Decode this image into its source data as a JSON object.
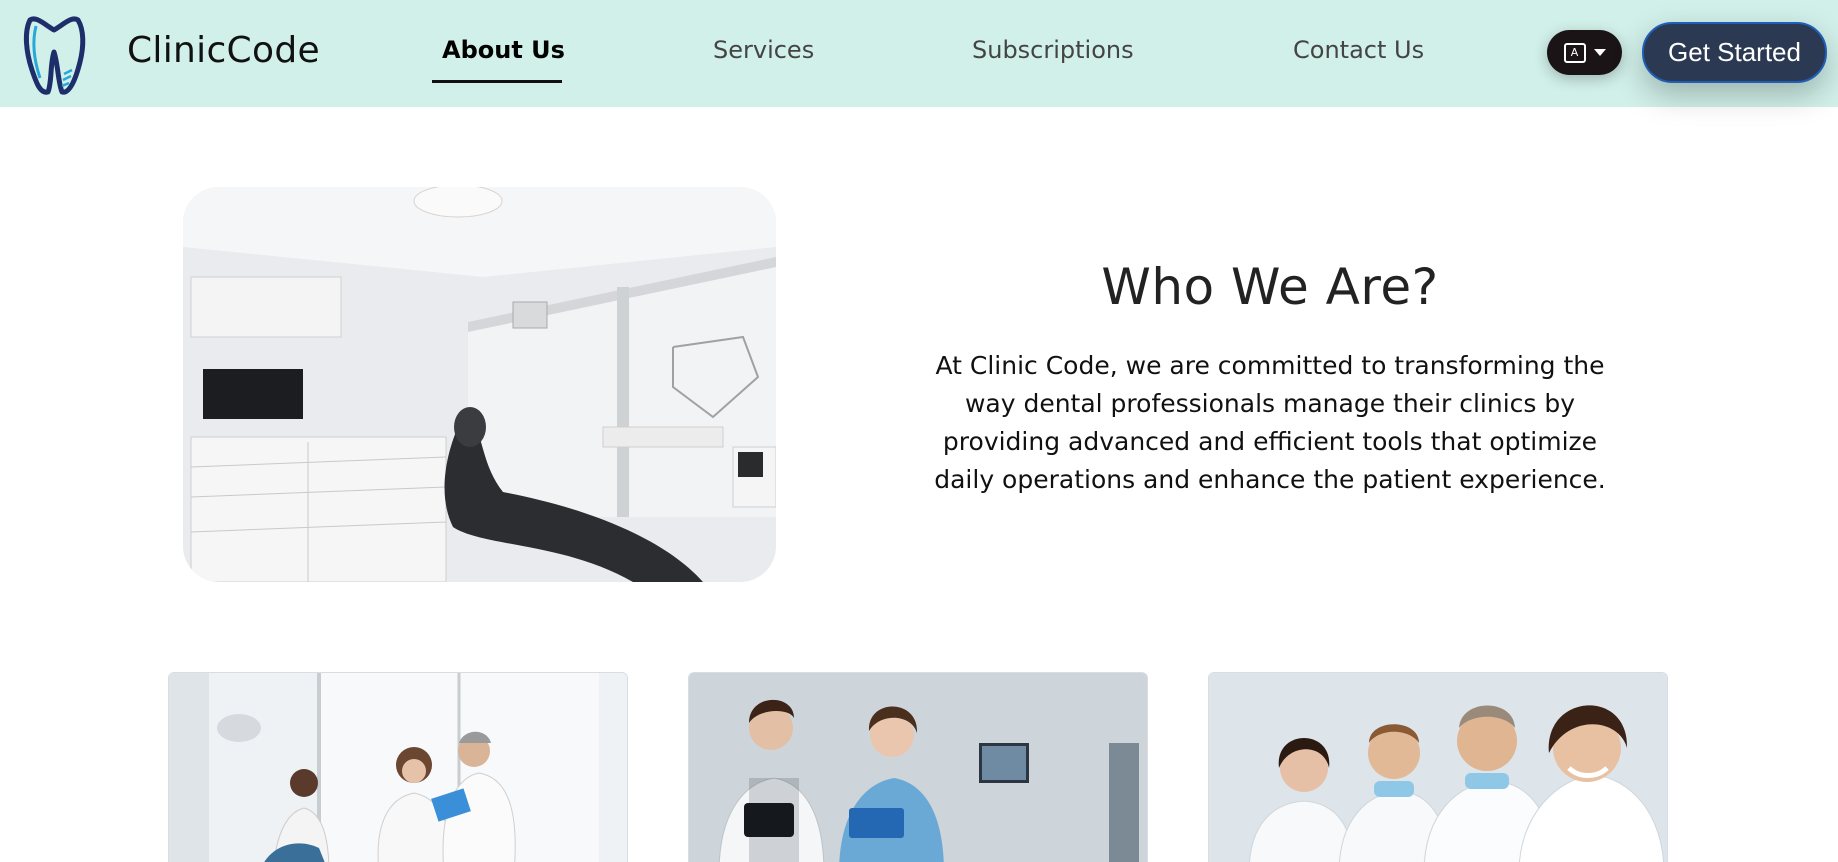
{
  "brand": {
    "name": "ClinicCode"
  },
  "nav": {
    "links": [
      {
        "label": "About Us",
        "active": true
      },
      {
        "label": "Services",
        "active": false
      },
      {
        "label": "Subscriptions",
        "active": false
      },
      {
        "label": "Contact Us",
        "active": false
      }
    ],
    "language_icon": "translate-icon",
    "cta_label": "Get Started"
  },
  "hero": {
    "title": "Who We Are?",
    "text": "At Clinic Code, we are committed to transforming the way dental professionals manage their clinics by providing advanced and efficient tools that optimize daily operations and enhance the patient experience."
  },
  "colors": {
    "header_bg": "#d1f0e9",
    "cta_bg": "#2b3a52",
    "lang_bg": "#1b1416"
  }
}
